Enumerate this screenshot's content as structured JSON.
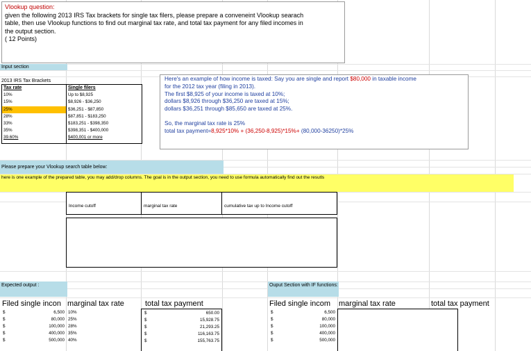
{
  "question": {
    "title": "Vlookup question:",
    "lines": [
      "given the following 2013 IRS Tax brackets for single tax filers, please prepare a conveneint Vlookup searach",
      "table, then use Vlookup functions to find out marginal tax rate, and total tax payment for any filed incomes in",
      "the output section.",
      "( 12 Points)"
    ]
  },
  "input_section_label": "Input section",
  "brackets_title": "2013 IRS Tax Brackets",
  "tax_table": {
    "rate_header": "Tax rate",
    "filer_header": "Single filers",
    "rates": [
      "10%",
      "15%",
      "25%",
      "28%",
      "33%",
      "35%",
      "39.60%"
    ],
    "filers": [
      "Up to $8,925",
      "$8,926 - $36,250",
      "$36,251 - $87,850",
      "$87,851 - $183,250",
      "$183,251 - $398,350",
      "$398,351 - $400,000",
      "$400,001 or more"
    ],
    "highlight_color": "#ffc000"
  },
  "example": {
    "line1_a": "Here's an example of how income is taxed: Say you are single and report ",
    "line1_b": "$80,000",
    "line1_c": " in taxable income",
    "line2": "for the 2012 tax year (filing in 2013).",
    "line3": "The first $8,925 of your income is taxed at 10%;",
    "line4": " dollars $8,926 through $36,250 are taxed at 15%;",
    "line5": "dollars $36,251 through $85,650 are taxed at 25%.",
    "line6": "So, the marginal tax rate is 25%",
    "line7_a": "total tax payment=",
    "line7_b": "8,925*10% + (36,250-8,925)*15%+",
    "line7_c": " (80,000-36250)*25%"
  },
  "prepare_label": "Please prepare your Vlookup search table below:",
  "prepare_note": "here is one example of the prepared table, you may add/drop columns. The goal is in the output section, you need to use formula automatically find out the resutls",
  "lookup_headers": [
    "Income cutoff",
    "marginal tax rate",
    "cumulative tax up to Income cutoff"
  ],
  "expected_output_label": "Expected output :",
  "output_if_label": "Ouput Section with IF functions:",
  "expected": {
    "h_income": "Filed single incon",
    "h_rate": "marginal tax rate",
    "h_total": "total tax payment",
    "dollar": "$",
    "incomes": [
      "6,500",
      "80,000",
      "100,000",
      "400,000",
      "500,000"
    ],
    "rates": [
      "10%",
      "25%",
      "28%",
      "35%",
      "40%"
    ],
    "totals": [
      "650.00",
      "15,928.75",
      "21,293.25",
      "116,163.75",
      "155,763.75"
    ]
  },
  "output_if": {
    "h_income": "Filed single incom",
    "h_rate": "marginal tax rate",
    "h_total": "total tax payment",
    "incomes": [
      "6,500",
      "80,000",
      "100,000",
      "400,000",
      "500,000"
    ]
  }
}
